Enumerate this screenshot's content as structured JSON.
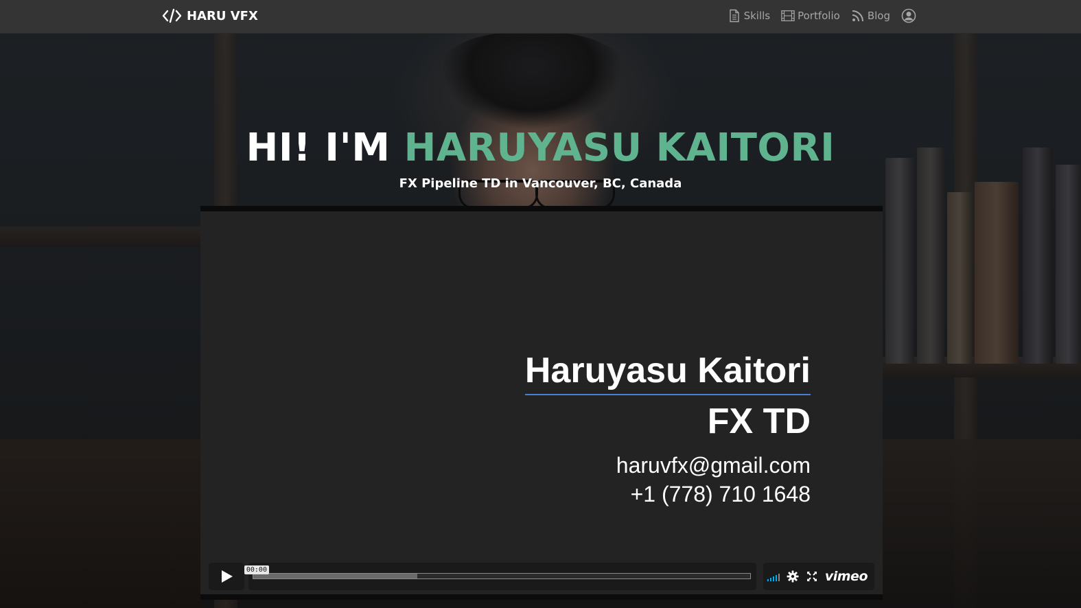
{
  "nav": {
    "brand": "HARU VFX",
    "links": [
      {
        "label": "Skills",
        "icon": "document-icon"
      },
      {
        "label": "Portfolio",
        "icon": "film-icon"
      },
      {
        "label": "Blog",
        "icon": "rss-icon"
      }
    ],
    "user_icon": "user-circle-icon"
  },
  "hero": {
    "greeting": "HI! I'M ",
    "name": "HARUYASU KAITORI",
    "subtitle": "FX Pipeline TD in Vancouver, BC, Canada"
  },
  "video": {
    "card_name": "Haruyasu Kaitori",
    "card_role": "FX TD",
    "card_email": "haruvfx@gmail.com",
    "card_phone": "+1 (778) 710 1648",
    "time_display": "00:00",
    "loaded_fraction": 0.33,
    "logo": "vimeo"
  },
  "colors": {
    "accent": "#5fb48f",
    "navbar": "#343434",
    "nav_text": "#a6a6a6",
    "vimeo_blue": "#00adef",
    "card_underline": "#4a7fd4"
  }
}
